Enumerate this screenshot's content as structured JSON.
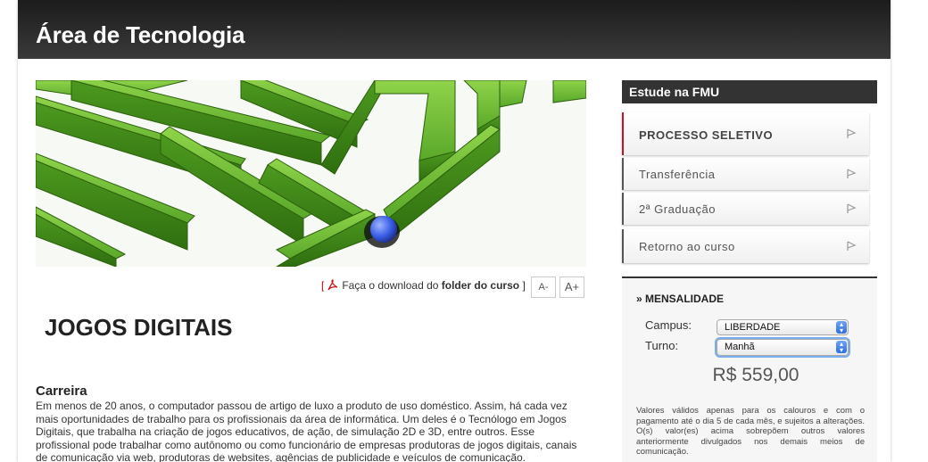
{
  "header": {
    "title": "Área de Tecnologia"
  },
  "hero": {
    "image": "green-maze-with-blue-ball",
    "colors": {
      "maze": "#5aa82a",
      "ball": "#3b5ee8"
    }
  },
  "download": {
    "open_bracket": "[",
    "prefix": "Faça o download do",
    "bold": "folder do curso",
    "close_bracket": "]",
    "icon": "pdf-icon"
  },
  "font_controls": {
    "decrease": "A-",
    "increase": "A+"
  },
  "course": {
    "title": "JOGOS DIGITAIS"
  },
  "career": {
    "title": "Carreira",
    "text": "Em menos de 20 anos, o computador passou de artigo de luxo a produto de uso doméstico. Assim, há cada vez mais oportunidades de trabalho para os profissionais da área de informática. Um deles é o Tecnólogo em Jogos Digitais, que trabalha na criação de jogos educativos, de ação, de simulação 2D e 3D, entre outros. Esse profissional pode trabalhar como autônomo ou como funcionário de empresas produtoras de jogos digitais, canais de comunicação via web, produtoras de websites, agências de publicidade e veículos de comunicação."
  },
  "sidebar": {
    "heading": "Estude na FMU",
    "items": [
      {
        "label": "PROCESSO SELETIVO",
        "active": true
      },
      {
        "label": "Transferência"
      },
      {
        "label": "2ª Graduação"
      },
      {
        "label": "Retorno ao curso"
      }
    ],
    "accent": "#c8102e"
  },
  "fees": {
    "title": "» MENSALIDADE",
    "campus_label": "Campus:",
    "campus_value": "LIBERDADE",
    "turno_label": "Turno:",
    "turno_value": "Manhã",
    "price": "R$ 559,00",
    "note": "Valores válidos apenas para os calouros e com o pagamento até o dia 5 de cada mês, e sujeitos a alterações. O(s) valor(es) acima sobrepõem outros valores anteriormente divulgados nos demais meios de comunicação."
  }
}
